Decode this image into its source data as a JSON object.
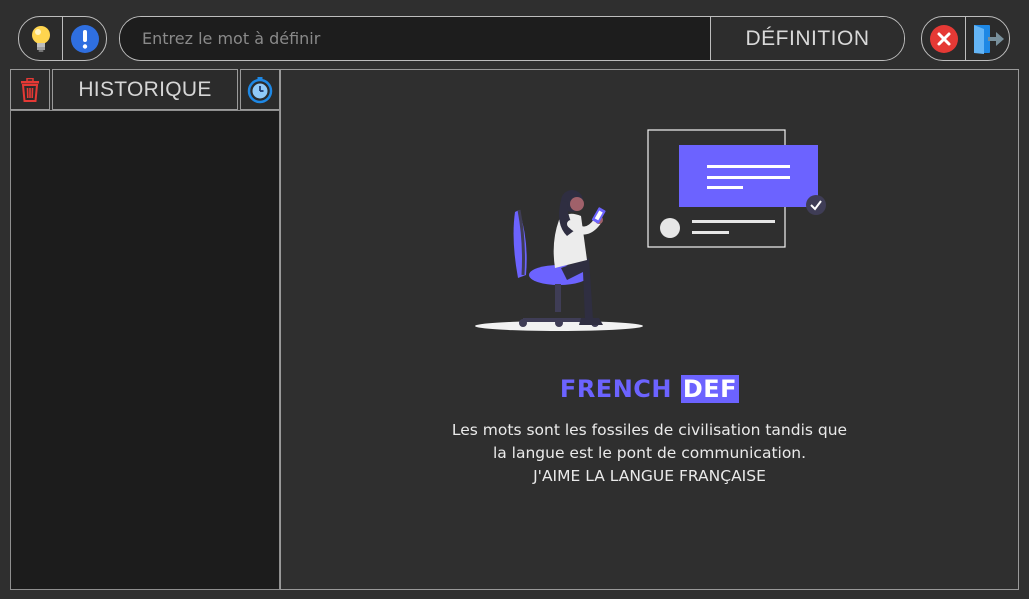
{
  "toolbar": {
    "hint_icon": "lightbulb-icon",
    "info_icon": "info-icon",
    "close_icon": "close-icon",
    "exit_icon": "exit-icon"
  },
  "search": {
    "placeholder": "Entrez le mot à définir",
    "value": "",
    "button_label": "DÉFINITION"
  },
  "sidebar": {
    "title": "HISTORIQUE",
    "delete_icon": "trash-icon",
    "history_icon": "timer-icon",
    "items": []
  },
  "main": {
    "brand_part1": "FRENCH",
    "brand_part2": "DEF",
    "quote_line1": "Les mots sont les fossiles de civilisation tandis que",
    "quote_line2": "la langue est le pont de communication.",
    "quote_line3": "J'AIME LA LANGUE FRANÇAISE"
  },
  "colors": {
    "accent": "#6c63ff",
    "background": "#2f2f2f",
    "sidebar_list": "#1c1c1c",
    "close_red": "#e53935",
    "info_blue": "#2f6fe0"
  }
}
